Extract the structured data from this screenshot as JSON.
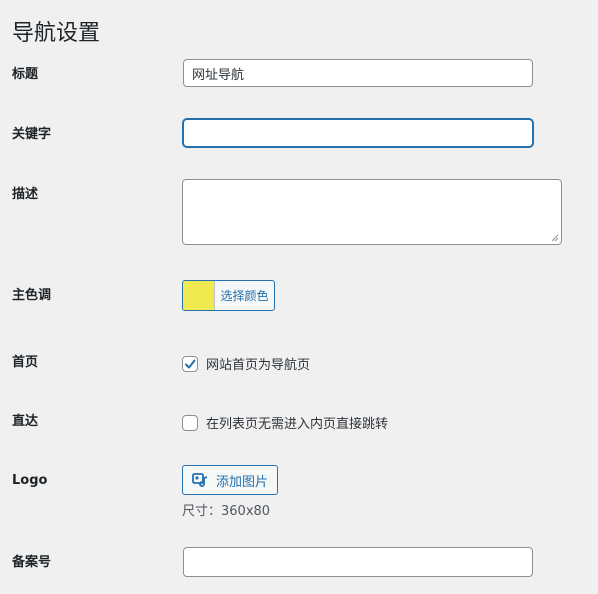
{
  "page": {
    "title": "导航设置"
  },
  "fields": {
    "title": {
      "label": "标题",
      "value": "网址导航"
    },
    "keywords": {
      "label": "关键字",
      "value": ""
    },
    "description": {
      "label": "描述",
      "value": ""
    },
    "color": {
      "label": "主色调",
      "button_label": "选择颜色",
      "swatch": "#eeea4f"
    },
    "homepage": {
      "label": "首页",
      "checkbox_label": "网站首页为导航页",
      "checked": true
    },
    "direct": {
      "label": "直达",
      "checkbox_label": "在列表页无需进入内页直接跳转",
      "checked": false
    },
    "logo": {
      "label": "Logo",
      "button_label": "添加图片",
      "size_note": "尺寸：360x80"
    },
    "icp": {
      "label": "备案号",
      "value": ""
    }
  },
  "colors": {
    "accent": "#2271b1",
    "background": "#f0f0f1"
  }
}
